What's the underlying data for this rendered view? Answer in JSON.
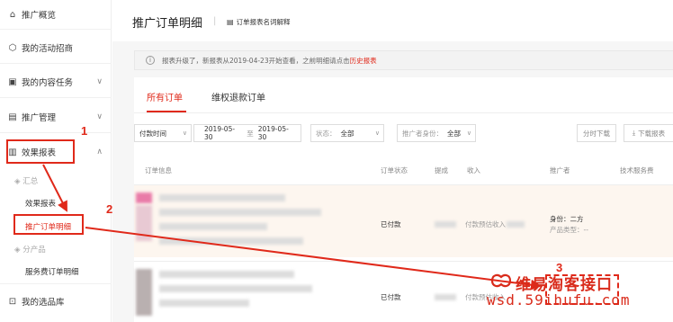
{
  "sidebar": {
    "items": [
      {
        "label": "推广概览",
        "icon": "home-icon"
      },
      {
        "label": "我的活动招商",
        "icon": "campaign-icon"
      },
      {
        "label": "我的内容任务",
        "icon": "task-icon"
      },
      {
        "label": "推广管理",
        "icon": "manage-icon"
      },
      {
        "label": "效果报表",
        "icon": "report-icon"
      },
      {
        "label": "我的选品库",
        "icon": "library-icon"
      }
    ],
    "sub": {
      "summary_group": "汇总",
      "effect_report": "效果报表",
      "promo_order_detail": "推广订单明细",
      "by_product": "分产品",
      "service_order_detail": "服务费订单明细"
    }
  },
  "header": {
    "title": "推广订单明细",
    "link": "订单报表名词解释"
  },
  "notice": {
    "text": "报表升级了，新报表从2019-04-23开始查看，之前明细请点击",
    "link": "历史报表"
  },
  "tabs": [
    {
      "label": "所有订单",
      "active": true
    },
    {
      "label": "维权退款订单",
      "active": false
    }
  ],
  "filters": {
    "time_type": "付款时间",
    "date_from": "2019-05-30",
    "date_to_sep": "至",
    "date_to": "2019-05-30",
    "status_label": "状态：",
    "status_value": "全部",
    "role_label": "推广者身份：",
    "role_value": "全部",
    "btn_download_tasks": "分时下载",
    "btn_download_report": "下载报表"
  },
  "table": {
    "headers": [
      "订单信息",
      "订单状态",
      "提成",
      "收入",
      "推广者",
      "技术服务费"
    ],
    "rows": [
      {
        "status": "已付款",
        "income_label": "付款预估收入",
        "promoter_role": "身份：二方",
        "product_type": "产品类型：--"
      },
      {
        "status": "已付款",
        "income_label": "付款预估收入",
        "promoter_role": "",
        "product_type": ""
      }
    ]
  },
  "annotations": [
    "1",
    "2",
    "3"
  ],
  "watermark": {
    "cn": "维易淘客接口",
    "url": "wsd.59ihufu.com"
  },
  "colors": {
    "accent": "#e0291a",
    "row_highlight": "#fdf6ef"
  }
}
